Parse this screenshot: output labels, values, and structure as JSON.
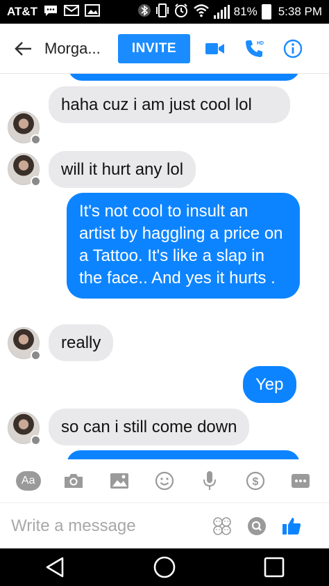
{
  "status_bar": {
    "carrier": "AT&T",
    "battery_percent": "81%",
    "time": "5:38 PM",
    "icons": [
      "message-icon",
      "mail-icon",
      "gallery-icon",
      "bluetooth-icon",
      "vibrate-icon",
      "alarm-icon",
      "wifi-icon",
      "signal-icon",
      "battery-icon"
    ]
  },
  "header": {
    "contact_name": "Morga...",
    "invite_label": "INVITE",
    "hd_label": "HD",
    "icons": [
      "back-arrow-icon",
      "video-call-icon",
      "phone-call-icon",
      "info-icon"
    ],
    "accent_color": "#1a8cff"
  },
  "messages": [
    {
      "direction": "out",
      "text": ""
    },
    {
      "direction": "in",
      "text": "haha cuz i am just cool lol"
    },
    {
      "direction": "in",
      "text": "will it hurt any lol"
    },
    {
      "direction": "out",
      "text": "It's not cool to insult an artist by haggling a price on a Tattoo. It's like a slap in the face.. And yes it hurts ."
    },
    {
      "direction": "in",
      "text": "really"
    },
    {
      "direction": "out",
      "text": "Yep"
    },
    {
      "direction": "in",
      "text": "so can i still come down"
    },
    {
      "direction": "out",
      "text": ""
    }
  ],
  "toolbar": {
    "text_format_label": "Aa",
    "icons": [
      "text-format-icon",
      "camera-icon",
      "photo-icon",
      "emoji-icon",
      "microphone-icon",
      "payment-icon",
      "more-icon"
    ]
  },
  "composer": {
    "placeholder": "Write a message",
    "icons": [
      "sticker-icon",
      "search-gif-icon",
      "thumbs-up-icon"
    ]
  },
  "navbar": {
    "icons": [
      "nav-back-icon",
      "nav-home-icon",
      "nav-recents-icon"
    ]
  },
  "colors": {
    "incoming_bubble": "#e9e9eb",
    "outgoing_bubble": "#0d84ff",
    "icon_gray": "#9a9a9a"
  }
}
